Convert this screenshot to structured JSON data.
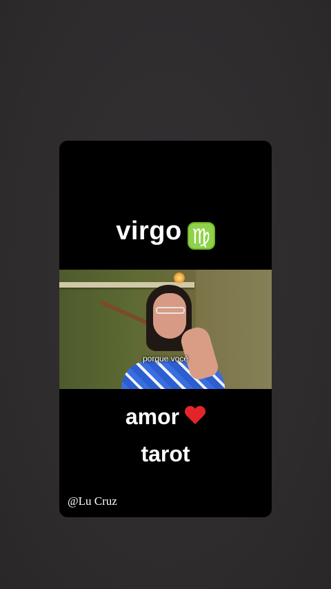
{
  "card": {
    "title": "virgo",
    "title_icon": "virgo-sign-icon",
    "title_icon_glyph": "♍",
    "title_icon_color": "#8fd24a",
    "video": {
      "subtitle": "porque você"
    },
    "line1": "amor",
    "line1_icon": "red-heart-icon",
    "heart_color": "#e3242b",
    "line2": "tarot",
    "credit": "@Lu Cruz"
  },
  "colors": {
    "background": "#2f2d2e",
    "card": "#000000",
    "text": "#ffffff"
  }
}
